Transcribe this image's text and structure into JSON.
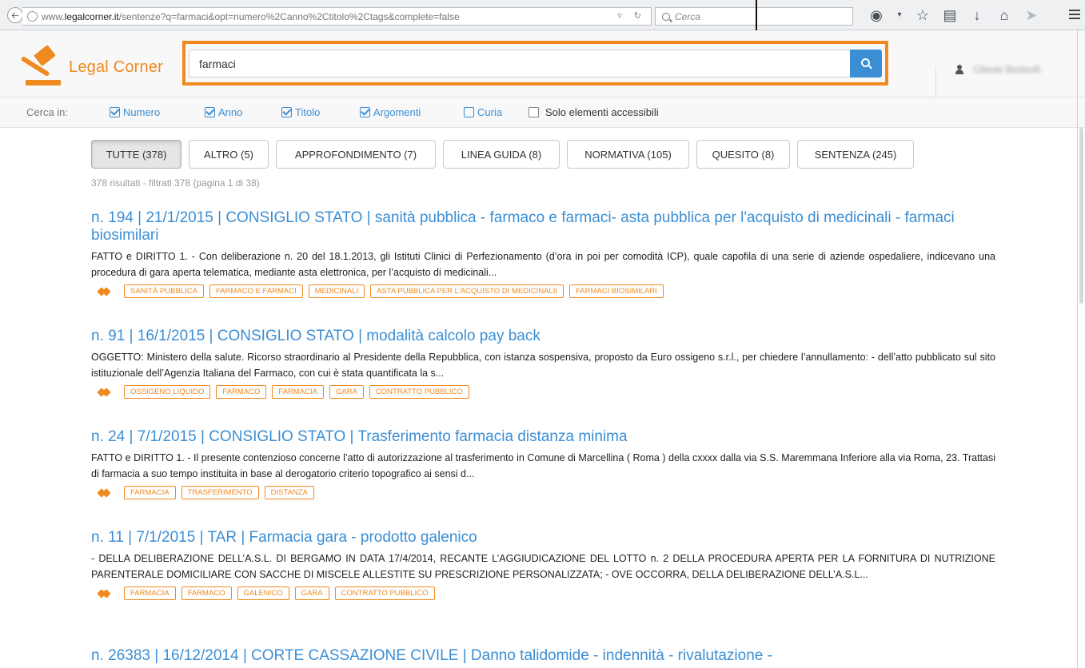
{
  "browser": {
    "url_prefix": "www.",
    "url_domain": "legalcorner.it",
    "url_rest": "/sentenze?q=farmaci&opt=numero%2Canno%2Ctitolo%2Ctags&complete=false",
    "search_placeholder": "Cerca"
  },
  "site": {
    "logo_text": "Legal Corner",
    "search_value": "farmaci",
    "user_name": "Cliente Bestsoft",
    "accent_color": "#ef8a1f",
    "link_color": "#3b8ed4"
  },
  "filters": {
    "label": "Cerca in:",
    "options": [
      {
        "label": "Numero",
        "checked": true
      },
      {
        "label": "Anno",
        "checked": true
      },
      {
        "label": "Titolo",
        "checked": true
      },
      {
        "label": "Argomenti",
        "checked": true
      },
      {
        "label": "Curia",
        "checked": false
      }
    ],
    "accessible_only": "Solo elementi accessibili"
  },
  "categories": [
    {
      "label": "TUTTE (378)",
      "active": true
    },
    {
      "label": "ALTRO (5)"
    },
    {
      "label": "APPROFONDIMENTO (7)"
    },
    {
      "label": "LINEA GUIDA (8)"
    },
    {
      "label": "NORMATIVA (105)"
    },
    {
      "label": "QUESITO (8)"
    },
    {
      "label": "SENTENZA (245)"
    }
  ],
  "result_count": "378 risultati - filtrati 378 (pagina 1 di 38)",
  "results": [
    {
      "title": "n. 194 | 21/1/2015 | CONSIGLIO STATO | sanità pubblica - farmaco e farmaci- asta pubblica per l'acquisto di medicinali - farmaci biosimilari",
      "text": "FATTO e DIRITTO 1. - Con deliberazione n. 20 del 18.1.2013, gli Istituti Clinici di Perfezionamento (d’ora in poi per comodità ICP), quale capofila di una serie di aziende ospedaliere, indicevano una procedura di gara aperta telematica, mediante asta elettronica, per l’acquisto di medicinali...",
      "tags": [
        "SANITÀ PUBBLICA",
        "FARMACO E FARMACI",
        "MEDICINALI",
        "ASTA PUBBLICA PER L'ACQUISTO DI MEDICINALII",
        "FARMACI BIOSIMILARI"
      ]
    },
    {
      "title": "n. 91 | 16/1/2015 | CONSIGLIO STATO | modalità calcolo pay back",
      "text": "OGGETTO: Ministero della salute. Ricorso straordinario al Presidente della Repubblica, con istanza sospensiva, proposto da Euro ossigeno s.r.l., per chiedere l’annullamento: - dell’atto pubblicato sul sito istituzionale dell’Agenzia Italiana del Farmaco, con cui è stata quantificata la s...",
      "tags": [
        "OSSIGENO LIQUIDO",
        "FARMACO",
        "FARMACIA",
        "GARA",
        "CONTRATTO PUBBLICO"
      ]
    },
    {
      "title": "n. 24 | 7/1/2015 | CONSIGLIO STATO | Trasferimento farmacia distanza minima",
      "text": "FATTO e DIRITTO 1. - Il presente contenzioso concerne l’atto di autorizzazione al trasferimento in Comune di Marcellina ( Roma ) della cxxxx dalla via S.S. Maremmana Inferiore alla via Roma, 23. Trattasi di farmacia a suo tempo instituita in base al derogatorio criterio topografico ai sensi d...",
      "tags": [
        "FARMACIA",
        "TRASFERIMENTO",
        "DISTANZA"
      ]
    },
    {
      "title": "n. 11 | 7/1/2015 | TAR | Farmacia gara - prodotto galenico",
      "text": "- DELLA DELIBERAZIONE DELL’A.S.L. DI BERGAMO IN DATA 17/4/2014, RECANTE L’AGGIUDICAZIONE DEL LOTTO n. 2 DELLA PROCEDURA APERTA PER LA FORNITURA DI NUTRIZIONE PARENTERALE DOMICILIARE CON SACCHE DI MISCELE ALLESTITE SU PRESCRIZIONE PERSONALIZZATA; - OVE OCCORRA, DELLA DELIBERAZIONE DELL’A.S.L...",
      "tags": [
        "FARMACIA",
        "FARMACO",
        "GALENICO",
        "GARA",
        "CONTRATTO PUBBLICO"
      ]
    },
    {
      "title": "n. 26383 | 16/12/2014 | CORTE CASSAZIONE CIVILE | Danno talidomide - indennità - rivalutazione -",
      "text": "",
      "tags": []
    }
  ]
}
